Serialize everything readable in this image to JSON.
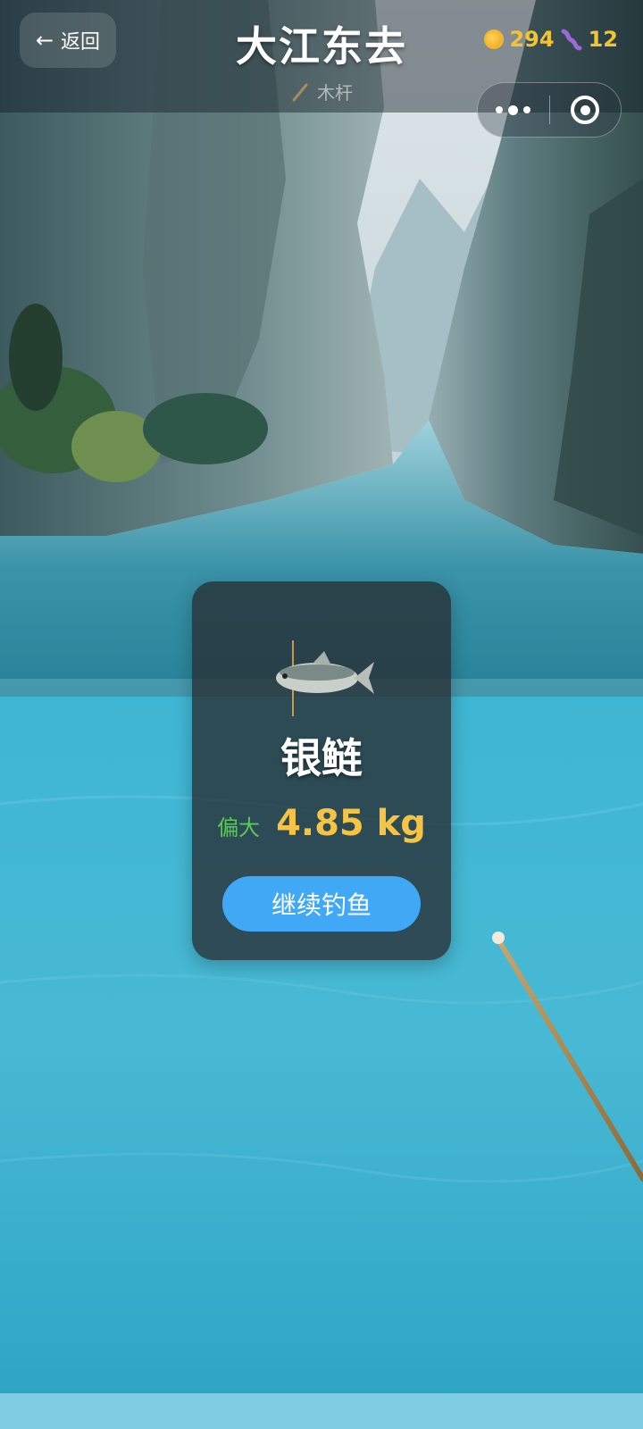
{
  "header": {
    "back_label": "返回",
    "title": "大江东去",
    "rod_name": "木杆",
    "coins": "294",
    "bait": "12"
  },
  "catch": {
    "fish_name": "银鲢",
    "size_tag": "偏大",
    "weight": "4.85 kg",
    "continue_label": "继续钓鱼"
  },
  "colors": {
    "coin": "#f4c430",
    "size_tag": "#5cc75a",
    "weight": "#f6c445",
    "continue_button": "#40a8f5",
    "water": "#3bb3d0"
  },
  "icons": [
    "back-arrow-icon",
    "rod-icon",
    "coin-icon",
    "worm-icon",
    "more-icon",
    "close-icon",
    "fish-icon",
    "fishing-rod-icon"
  ]
}
